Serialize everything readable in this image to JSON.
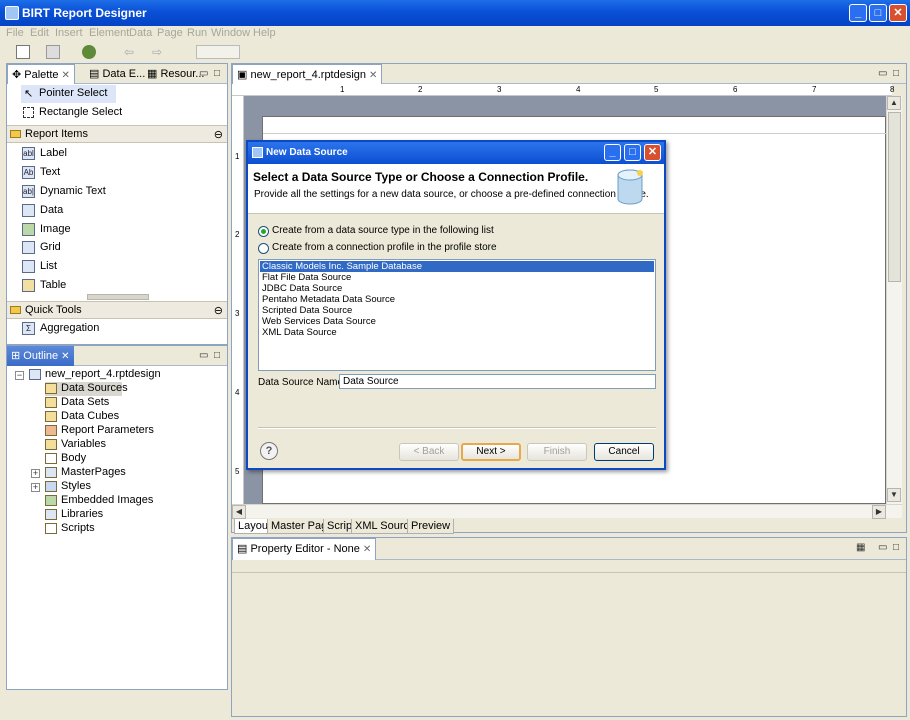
{
  "window": {
    "title": "BIRT Report Designer"
  },
  "menu": [
    "File",
    "Edit",
    "Insert",
    "Element",
    "Data",
    "Page",
    "Run",
    "Window",
    "Help"
  ],
  "left_top": {
    "tabs": [
      {
        "label": "Palette"
      },
      {
        "label": "Data E..."
      },
      {
        "label": "Resour..."
      }
    ],
    "tools": [
      {
        "label": "Pointer Select"
      },
      {
        "label": "Rectangle Select"
      }
    ],
    "report_items_title": "Report Items",
    "report_items": [
      {
        "label": "Label",
        "icon": "abl"
      },
      {
        "label": "Text",
        "icon": "Ab"
      },
      {
        "label": "Dynamic Text",
        "icon": "ab|"
      },
      {
        "label": "Data",
        "icon": ""
      },
      {
        "label": "Image",
        "icon": ""
      },
      {
        "label": "Grid",
        "icon": ""
      },
      {
        "label": "List",
        "icon": ""
      },
      {
        "label": "Table",
        "icon": ""
      }
    ],
    "quick_tools_title": "Quick Tools",
    "quick_tools": [
      {
        "label": "Aggregation",
        "icon": "Σ"
      }
    ]
  },
  "outline": {
    "tab": "Outline",
    "root": "new_report_4.rptdesign",
    "items": [
      {
        "label": "Data Sources",
        "selected": true
      },
      {
        "label": "Data Sets"
      },
      {
        "label": "Data Cubes"
      },
      {
        "label": "Report Parameters"
      },
      {
        "label": "Variables"
      },
      {
        "label": "Body"
      },
      {
        "label": "MasterPages",
        "expandable": true
      },
      {
        "label": "Styles",
        "expandable": true
      },
      {
        "label": "Embedded Images"
      },
      {
        "label": "Libraries"
      },
      {
        "label": "Scripts"
      }
    ]
  },
  "editor": {
    "tab": "new_report_4.rptdesign",
    "ruler_numbers": [
      "1",
      "2",
      "3",
      "4",
      "5",
      "6",
      "7",
      "8"
    ],
    "vruler_numbers": [
      "1",
      "2",
      "3",
      "4",
      "5"
    ],
    "bottom_tabs": [
      "Layout",
      "Master Page",
      "Script",
      "XML Source",
      "Preview"
    ]
  },
  "properties": {
    "tab": "Property Editor - None"
  },
  "dialog": {
    "title": "New Data Source",
    "heading": "Select a Data Source Type or Choose a Connection Profile.",
    "subheading": "Provide all the settings for a new data source, or choose a pre-defined connection profile.",
    "radio1": "Create from a data source type in the following list",
    "radio2": "Create from a connection profile in the profile store",
    "list": [
      "Classic Models Inc. Sample Database",
      "Flat File Data Source",
      "JDBC Data Source",
      "Pentaho Metadata Data Source",
      "Scripted Data Source",
      "Web Services Data Source",
      "XML Data Source"
    ],
    "name_label": "Data Source Name:",
    "name_value": "Data Source",
    "buttons": {
      "back": "< Back",
      "next": "Next >",
      "finish": "Finish",
      "cancel": "Cancel"
    }
  },
  "colors": {
    "title_blue": "#0a50d8",
    "selection": "#316ac5",
    "canvas": "#8b94a4"
  }
}
